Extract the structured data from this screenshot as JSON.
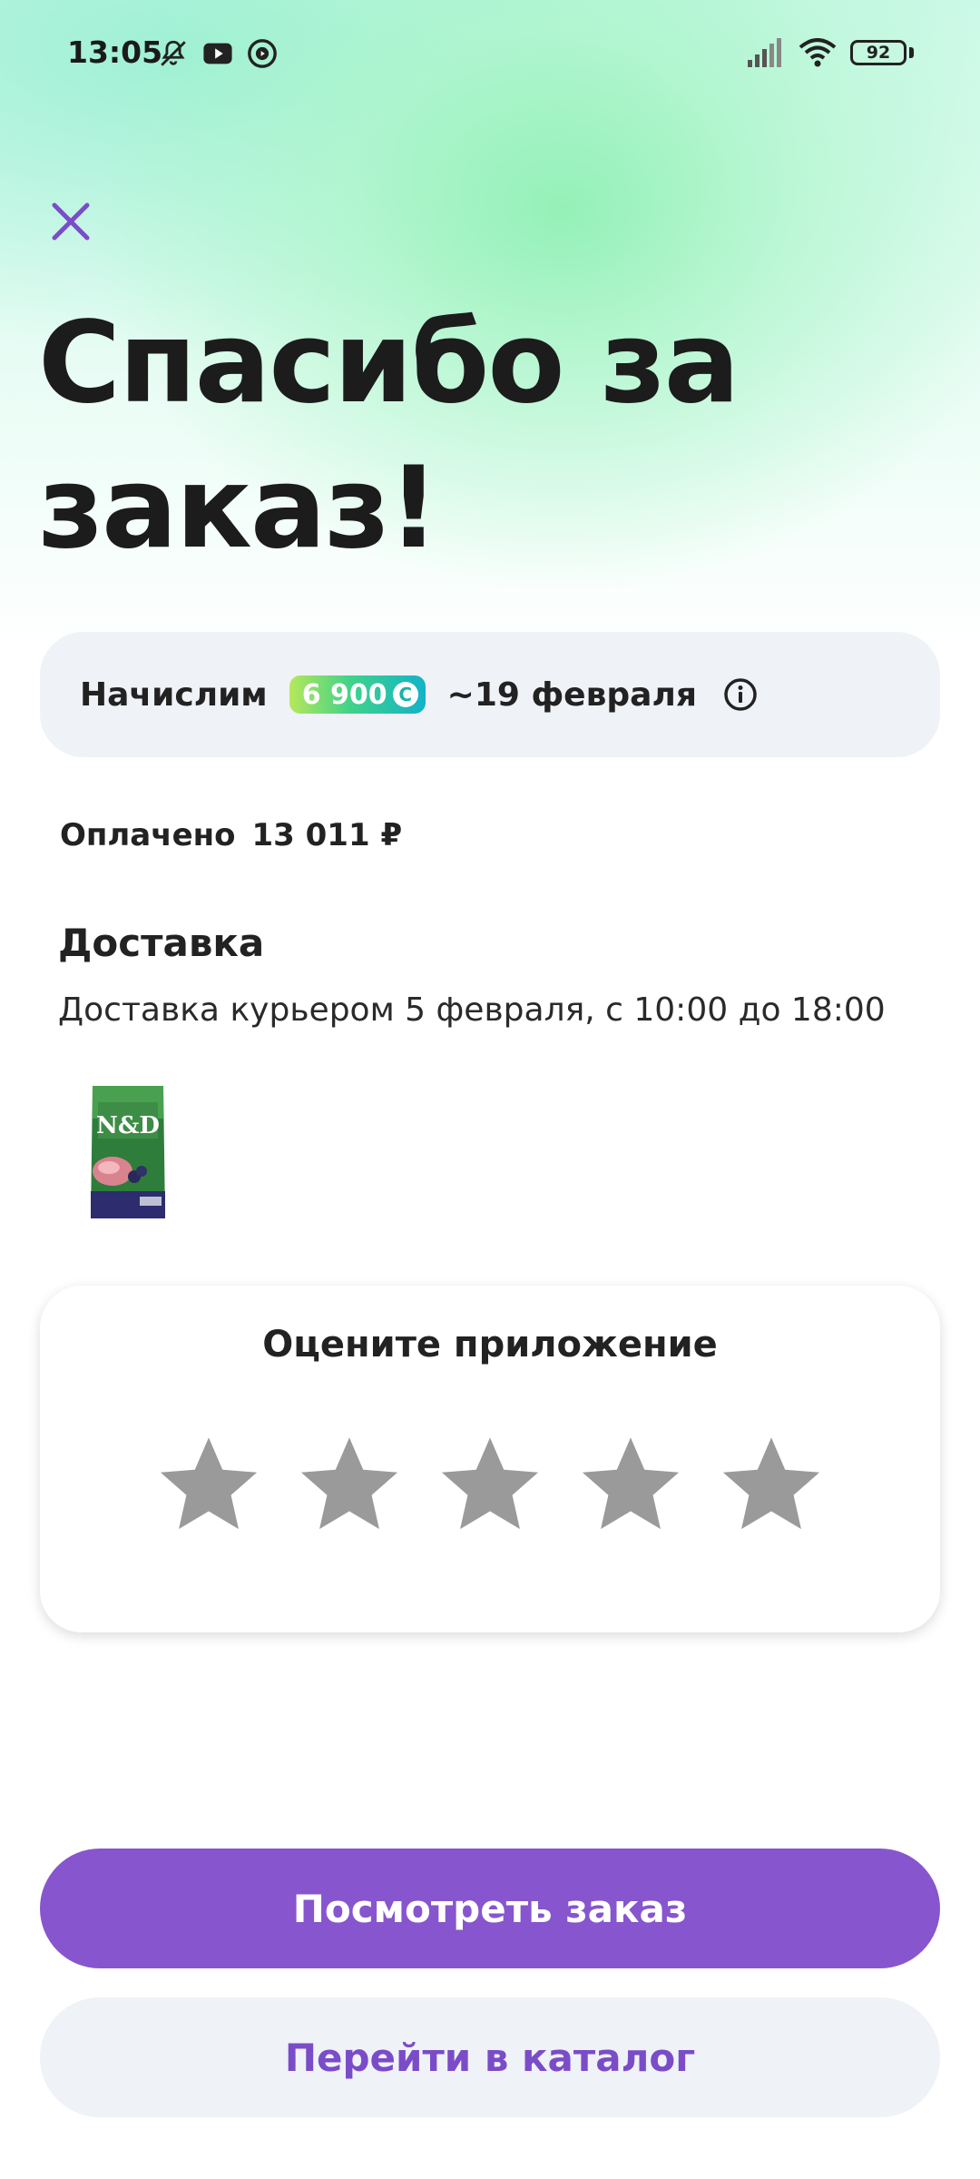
{
  "status_bar": {
    "time": "13:05",
    "battery": "92",
    "icons": [
      "bell-off-icon",
      "youtube-icon",
      "media-icon",
      "signal-icon",
      "wifi-icon",
      "battery-icon"
    ]
  },
  "header": {
    "close_icon": "close-icon",
    "title": "Спасибо за заказ!"
  },
  "bonus": {
    "label": "Начислим",
    "amount": "6 900",
    "coin_symbol": "C",
    "date": "~19 февраля",
    "info_icon": "info-icon"
  },
  "payment": {
    "label": "Оплачено",
    "amount": "13 011 ₽"
  },
  "delivery": {
    "title": "Доставка",
    "text": "Доставка курьером 5 февраля, с 10:00 до 18:00",
    "product_thumb_text": "N&D"
  },
  "rating": {
    "title": "Оцените приложение",
    "max_stars": 5,
    "selected": 0
  },
  "actions": {
    "primary_label": "Посмотреть заказ",
    "secondary_label": "Перейти в каталог"
  },
  "colors": {
    "accent": "#8755cd",
    "secondary_bg": "#eff2f6",
    "star_empty": "#9a9a9a"
  }
}
